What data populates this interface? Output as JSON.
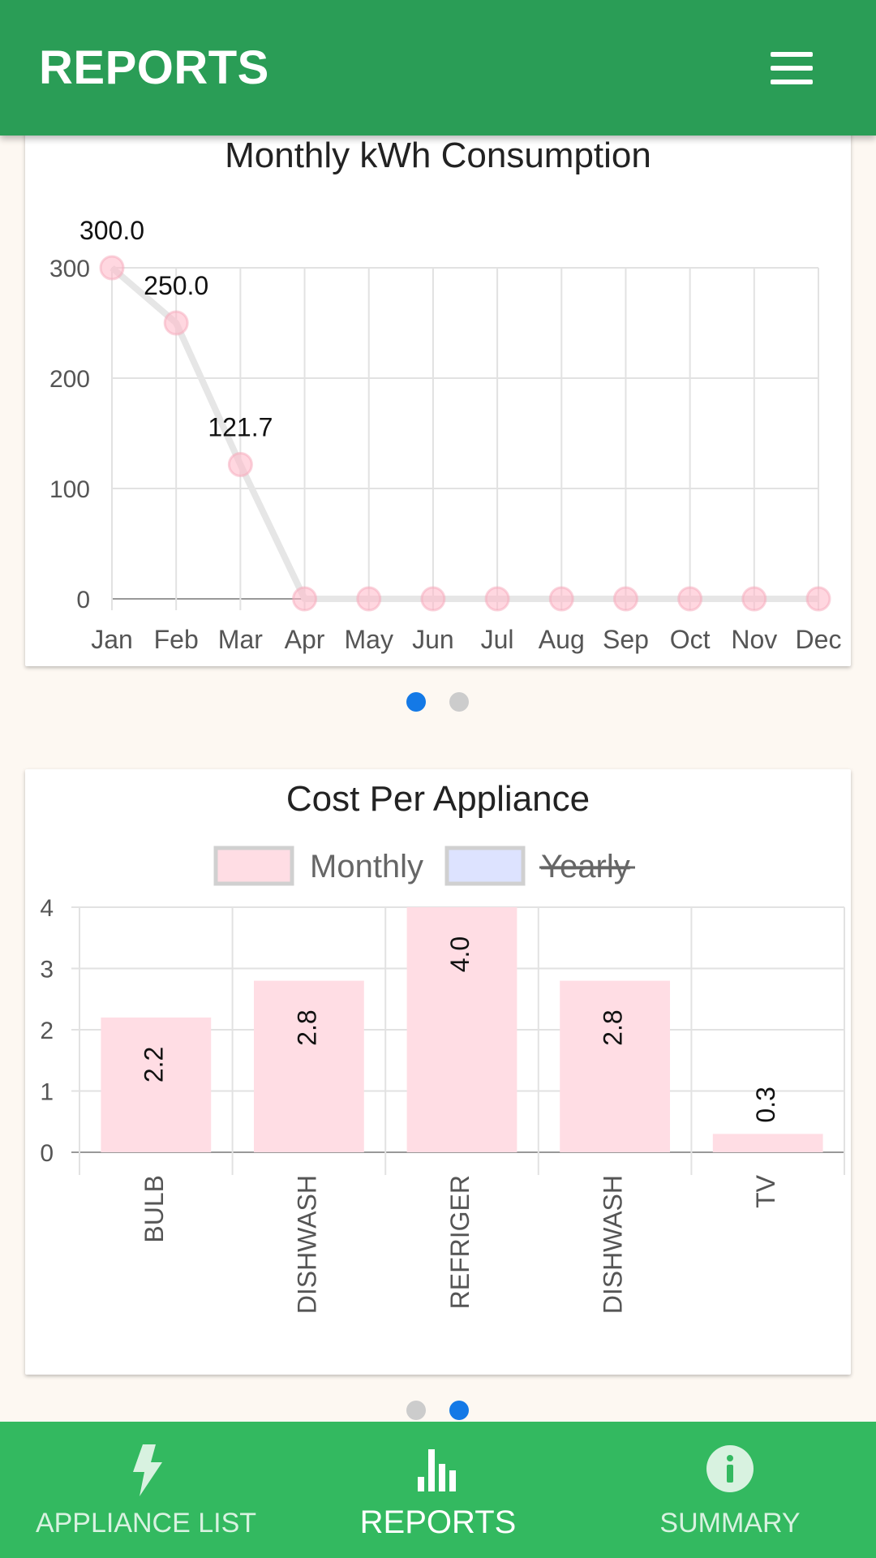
{
  "appbar": {
    "title": "REPORTS",
    "menu_icon": "hamburger-menu-icon"
  },
  "chart_data": [
    {
      "type": "line",
      "title": "Monthly kWh Consumption",
      "categories": [
        "Jan",
        "Feb",
        "Mar",
        "Apr",
        "May",
        "Jun",
        "Jul",
        "Aug",
        "Sep",
        "Oct",
        "Nov",
        "Dec"
      ],
      "values": [
        300.0,
        250.0,
        121.7,
        0,
        0,
        0,
        0,
        0,
        0,
        0,
        0,
        0
      ],
      "data_labels": [
        "300.0",
        "250.0",
        "121.7",
        "",
        "",
        "",
        "",
        "",
        "",
        "",
        "",
        ""
      ],
      "yticks": [
        0,
        100,
        200,
        300
      ],
      "ylim": [
        0,
        300
      ],
      "grid": true,
      "color": "#e6e6e6",
      "point_color": "#ffb6c6"
    },
    {
      "type": "bar",
      "title": "Cost Per Appliance",
      "categories": [
        "BULB",
        "DISHWASH",
        "REFRIGER",
        "DISHWASH",
        "TV"
      ],
      "series": [
        {
          "name": "Monthly",
          "values": [
            2.2,
            2.8,
            4.0,
            2.8,
            0.3
          ],
          "color": "#ffdde4",
          "hidden": false
        },
        {
          "name": "Yearly",
          "values": [],
          "color": "#dde3ff",
          "hidden": true
        }
      ],
      "data_labels": [
        "2.2",
        "2.8",
        "4.0",
        "2.8",
        "0.3"
      ],
      "yticks": [
        0,
        1,
        2,
        3,
        4
      ],
      "ylim": [
        0,
        4
      ],
      "grid": true,
      "legend_position": "top"
    }
  ],
  "pager": {
    "pages": 2,
    "chart1_active": 0,
    "chart2_active": 1
  },
  "bottom_nav": {
    "items": [
      {
        "label": "APPLIANCE LIST",
        "icon": "lightning-bolt-icon",
        "active": false
      },
      {
        "label": "REPORTS",
        "icon": "bar-chart-icon",
        "active": true
      },
      {
        "label": "SUMMARY",
        "icon": "info-icon",
        "active": false
      }
    ]
  }
}
